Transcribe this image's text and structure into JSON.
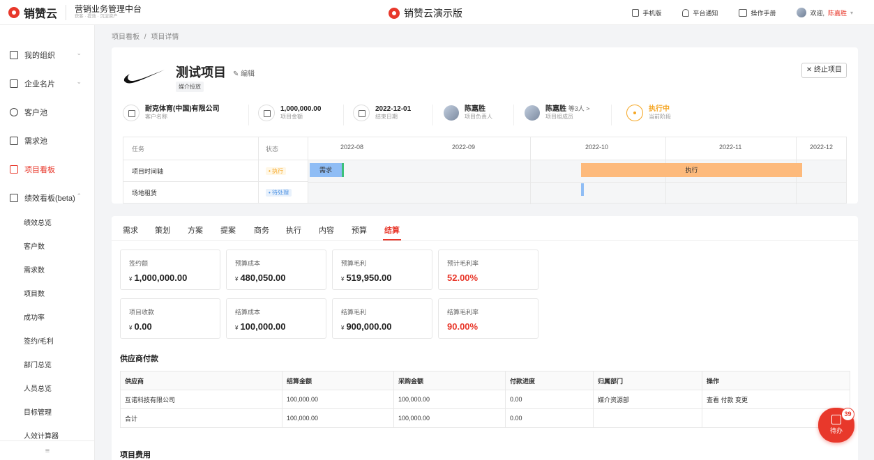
{
  "header": {
    "logo_text": "销赞云",
    "system_title": "营销业务管理中台",
    "system_sub": "获客 · 提效 · 沉淀资产",
    "center_title": "销赞云演示版",
    "mobile": "手机版",
    "notify": "平台通知",
    "manual": "操作手册",
    "welcome": "欢迎,",
    "user": "陈嘉胜"
  },
  "sidebar": {
    "items": [
      {
        "label": "我的组织"
      },
      {
        "label": "企业名片"
      },
      {
        "label": "客户池"
      },
      {
        "label": "需求池"
      },
      {
        "label": "项目看板"
      },
      {
        "label": "绩效看板(beta)"
      }
    ],
    "sub_items": [
      "绩效总览",
      "客户数",
      "需求数",
      "项目数",
      "成功率",
      "签约/毛利",
      "部门总览",
      "人员总览",
      "目标管理",
      "人效计算器"
    ],
    "collapse": "≡"
  },
  "breadcrumb": {
    "root": "项目看板",
    "sep": "/",
    "current": "项目详情"
  },
  "project": {
    "title": "测试项目",
    "edit": "编辑",
    "tag": "媒介投放",
    "stop": "终止项目",
    "info": [
      {
        "value": "耐克体育(中国)有限公司",
        "label": "客户名称"
      },
      {
        "value": "1,000,000.00",
        "label": "项目金额"
      },
      {
        "value": "2022-12-01",
        "label": "结束日期"
      },
      {
        "value": "陈嘉胜",
        "label": "项目负责人"
      },
      {
        "value": "陈嘉胜",
        "extra": "等3人 >",
        "label": "项目组成员"
      },
      {
        "value": "执行中",
        "label": "当前阶段"
      }
    ]
  },
  "gantt": {
    "col_task": "任务",
    "col_status": "状态",
    "rows": [
      {
        "task": "项目时间轴",
        "status": "执行"
      },
      {
        "task": "场地租赁",
        "status": "待处理"
      }
    ],
    "months": [
      "2022-08",
      "2022-09",
      "2022-10",
      "2022-11",
      "2022-12"
    ],
    "bar_need": "需求",
    "bar_exec": "执行"
  },
  "tabs": [
    "需求",
    "策划",
    "方案",
    "提案",
    "商务",
    "执行",
    "内容",
    "预算",
    "结算"
  ],
  "kpis": [
    {
      "label": "签约额",
      "value": "1,000,000.00"
    },
    {
      "label": "预算成本",
      "value": "480,050.00"
    },
    {
      "label": "预算毛利",
      "value": "519,950.00"
    },
    {
      "label": "预计毛利率",
      "value": "52.00%"
    },
    {
      "label": "项目收款",
      "value": "0.00"
    },
    {
      "label": "结算成本",
      "value": "100,000.00"
    },
    {
      "label": "结算毛利",
      "value": "900,000.00"
    },
    {
      "label": "结算毛利率",
      "value": "90.00%"
    }
  ],
  "currency": "¥",
  "supplier": {
    "title": "供应商付款",
    "headers": [
      "供应商",
      "结算金额",
      "采购金额",
      "付款进度",
      "归属部门",
      "操作"
    ],
    "rows": [
      [
        "互诺科技有限公司",
        "100,000.00",
        "100,000.00",
        "0.00",
        "媒介资源部",
        "查看 付款 变更"
      ],
      [
        "合计",
        "100,000.00",
        "100,000.00",
        "0.00",
        "",
        ""
      ]
    ]
  },
  "expense_title": "项目费用",
  "fab": {
    "label": "待办",
    "badge": "39"
  }
}
